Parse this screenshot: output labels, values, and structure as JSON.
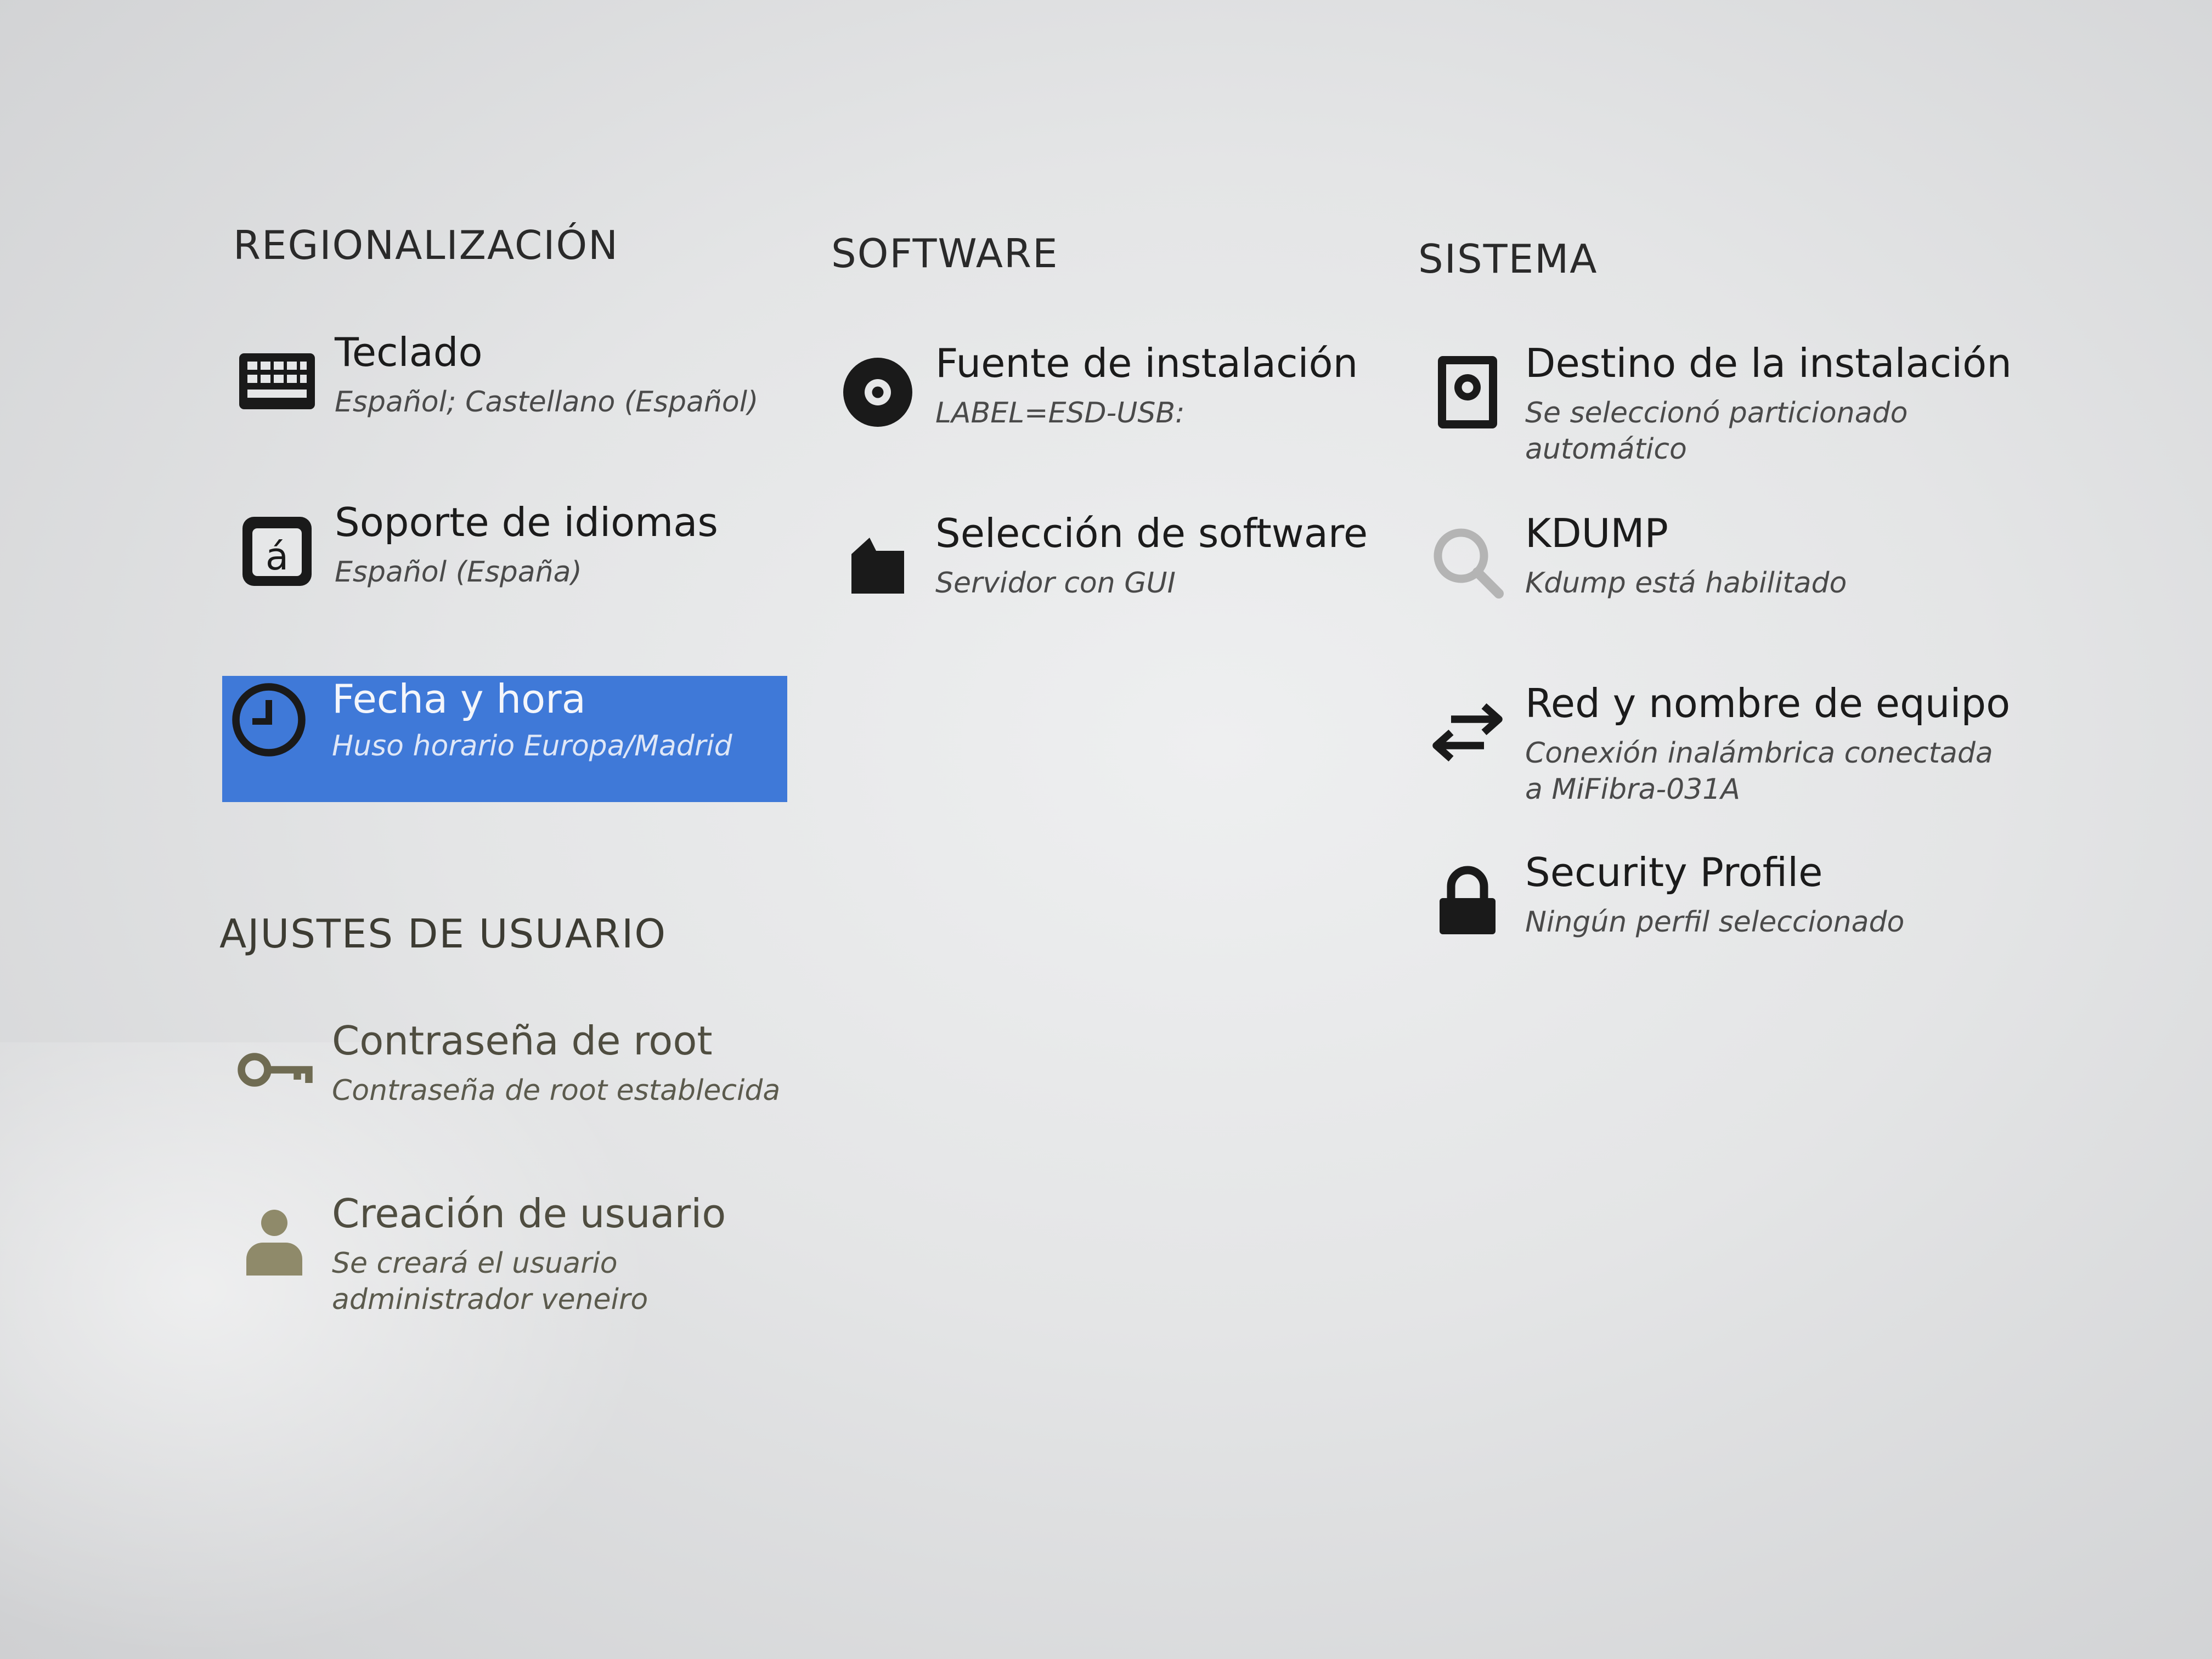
{
  "colors": {
    "selected_background": "#3f79d8",
    "background": "#e6e7e8"
  },
  "sections": {
    "localization": {
      "title": "REGIONALIZACIÓN"
    },
    "software": {
      "title": "SOFTWARE"
    },
    "system": {
      "title": "SISTEMA"
    },
    "user_settings": {
      "title": "AJUSTES DE USUARIO"
    }
  },
  "spokes": {
    "keyboard": {
      "title": "Teclado",
      "status": "Español; Castellano (Español)",
      "icon": "keyboard-icon"
    },
    "language": {
      "title": "Soporte de idiomas",
      "status": "Español (España)",
      "icon": "language-icon"
    },
    "datetime": {
      "title": "Fecha y hora",
      "status": "Huso horario Europa/Madrid",
      "icon": "clock-icon",
      "selected": true
    },
    "source": {
      "title": "Fuente de instalación",
      "status": "LABEL=ESD-USB:",
      "icon": "disc-icon"
    },
    "software_selection": {
      "title": "Selección de software",
      "status": "Servidor con GUI",
      "icon": "package-icon"
    },
    "destination": {
      "title": "Destino de la instalación",
      "status": "Se seleccionó particionado automático",
      "icon": "disk-icon"
    },
    "kdump": {
      "title": "KDUMP",
      "status": "Kdump está habilitado",
      "icon": "magnifier-icon"
    },
    "network": {
      "title": "Red y nombre de equipo",
      "status": "Conexión inalámbrica conectada a MiFibra-031A",
      "icon": "network-arrows-icon"
    },
    "security": {
      "title": "Security Profile",
      "status": "Ningún perfil seleccionado",
      "icon": "lock-icon"
    },
    "root_password": {
      "title": "Contraseña de root",
      "status": "Contraseña de root establecida",
      "icon": "key-icon"
    },
    "user_creation": {
      "title": "Creación de usuario",
      "status": "Se creará el usuario administrador veneiro",
      "icon": "user-icon"
    }
  }
}
